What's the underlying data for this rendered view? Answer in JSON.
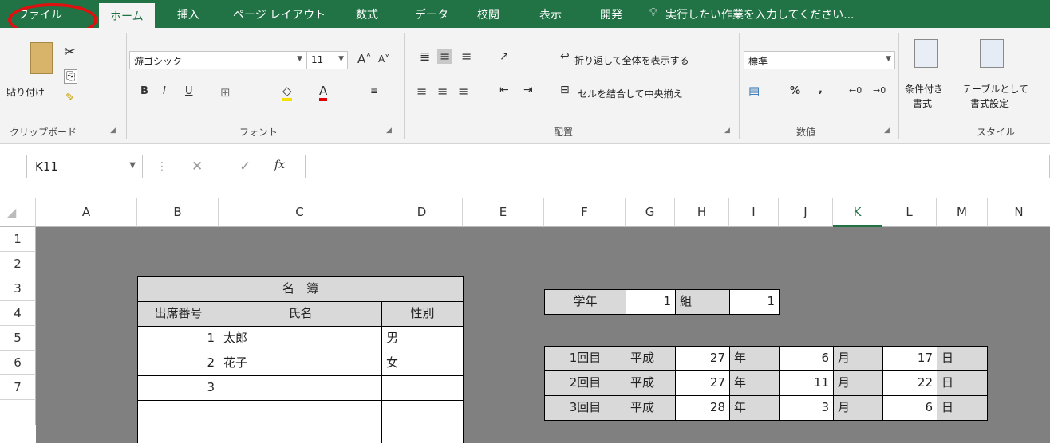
{
  "tabs": [
    {
      "label": "ファイル"
    },
    {
      "label": "ホーム"
    },
    {
      "label": "挿入"
    },
    {
      "label": "ページ レイアウト"
    },
    {
      "label": "数式"
    },
    {
      "label": "データ"
    },
    {
      "label": "校閲"
    },
    {
      "label": "表示"
    },
    {
      "label": "開発"
    },
    {
      "label": "実行したい作業を入力してください..."
    }
  ],
  "ribbon": {
    "clipboard": {
      "paste": "貼り付け",
      "group": "クリップボード"
    },
    "font": {
      "name": "游ゴシック",
      "size": "11",
      "group": "フォント",
      "bold": "B",
      "italic": "I",
      "underline": "U"
    },
    "alignment": {
      "wrap": "折り返して全体を表示する",
      "merge": "セルを結合して中央揃え",
      "group": "配置"
    },
    "number": {
      "format": "標準",
      "percent": "%",
      "comma": ",",
      "group": "数値"
    },
    "styles": {
      "conditional_line1": "条件付き",
      "conditional_line2": "書式",
      "table_line1": "テーブルとして",
      "table_line2": "書式設定",
      "group": "スタイル"
    }
  },
  "formula_bar": {
    "name_box": "K11",
    "fx": "fx",
    "value": ""
  },
  "columns": [
    "A",
    "B",
    "C",
    "D",
    "E",
    "F",
    "G",
    "H",
    "I",
    "J",
    "K",
    "L",
    "M",
    "N"
  ],
  "rows": [
    "1",
    "2",
    "3",
    "4",
    "5",
    "6",
    "7"
  ],
  "roster": {
    "title": "名　簿",
    "headers": [
      "出席番号",
      "氏名",
      "性別"
    ],
    "rows": [
      [
        "1",
        "太郎",
        "男"
      ],
      [
        "2",
        "花子",
        "女"
      ],
      [
        "3",
        "",
        ""
      ]
    ]
  },
  "class_info": {
    "grade_label": "学年",
    "grade": "1",
    "class_label": "組",
    "class": "1"
  },
  "sessions": [
    {
      "label": "1回目",
      "era": "平成",
      "year": "27",
      "year_unit": "年",
      "month": "6",
      "month_unit": "月",
      "day": "17",
      "day_unit": "日"
    },
    {
      "label": "2回目",
      "era": "平成",
      "year": "27",
      "year_unit": "年",
      "month": "11",
      "month_unit": "月",
      "day": "22",
      "day_unit": "日"
    },
    {
      "label": "3回目",
      "era": "平成",
      "year": "28",
      "year_unit": "年",
      "month": "3",
      "month_unit": "月",
      "day": "6",
      "day_unit": "日"
    }
  ],
  "colors": {
    "ribbon_green": "#217346",
    "highlight_circle": "#e01010",
    "sheet_gray": "#808080"
  }
}
